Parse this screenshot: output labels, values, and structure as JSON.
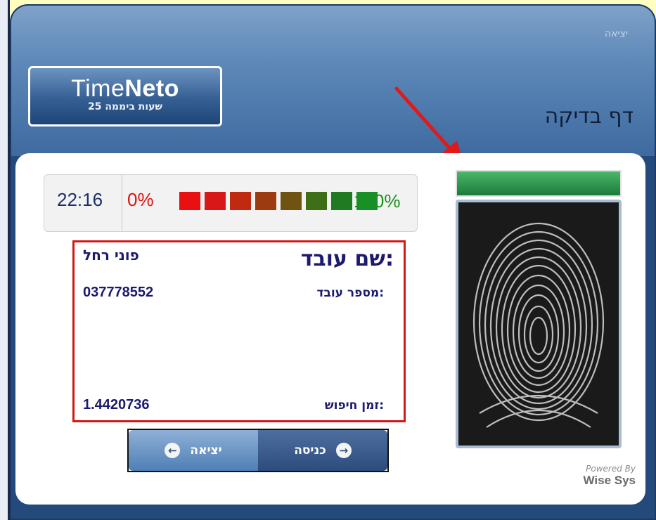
{
  "header": {
    "exit_link": "יציאה",
    "page_title": "דף בדיקה"
  },
  "logo": {
    "brand_light": "Time",
    "brand_bold": "Neto",
    "tagline": "25 שעות ביממה"
  },
  "status": {
    "time": "22:16",
    "percent_low": "0%",
    "percent_high": "100%",
    "quality_colors": [
      "#e81010",
      "#d81818",
      "#c02a10",
      "#9c3a10",
      "#6e5410",
      "#3e6e18",
      "#1f7a22",
      "#18902a"
    ]
  },
  "employee": {
    "name_label": "שם עובד:",
    "name_value": "פוני רחל",
    "id_label": "מספר עובד:",
    "id_value": "037778552",
    "search_time_label": "זמן חיפוש:",
    "search_time_value": "1.4420736"
  },
  "buttons": {
    "exit_label": "יציאה",
    "enter_label": "כניסה"
  },
  "footer": {
    "powered_by": "Powered By",
    "company": "Wise Sys"
  },
  "colors": {
    "accent": "#244a7c",
    "highlight_box": "#d01818",
    "arrow": "#e01a1a",
    "scanner_ok": "#2a9a4a"
  }
}
